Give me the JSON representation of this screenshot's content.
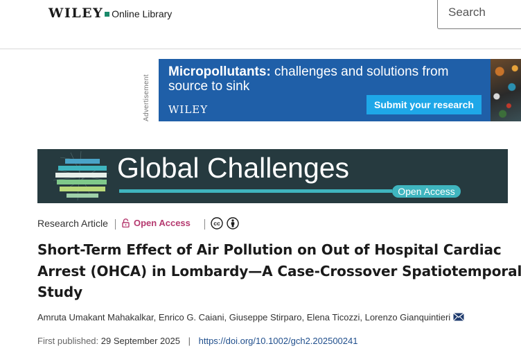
{
  "header": {
    "logo_brand": "WILEY",
    "logo_product": "Online Library",
    "search_placeholder": "Search"
  },
  "advertisement": {
    "label": "Advertisement",
    "headline_bold": "Micropollutants:",
    "headline_rest": " challenges and solutions from source to sink",
    "brand": "WILEY",
    "cta": "Submit your research",
    "colors": {
      "background": "#1f5fa8",
      "button": "#1ea7e8"
    }
  },
  "journal_banner": {
    "title": "Global Challenges",
    "badge": "Open Access",
    "colors": {
      "background": "#263a3f",
      "accent": "#3fb5bf"
    }
  },
  "article": {
    "type": "Research Article",
    "access": "Open Access",
    "license_icons": [
      "creative-commons-icon",
      "attribution-icon"
    ],
    "title": "Short-Term Effect of Air Pollution on Out of Hospital Cardiac Arrest (OHCA) in Lombardy—A Case-Crossover Spatiotemporal Study",
    "authors": [
      "Amruta Umakant Mahakalkar",
      "Enrico G. Caiani",
      "Giuseppe Stirparo",
      "Elena Ticozzi",
      "Lorenzo Gianquintieri"
    ],
    "corresponding_author_icon": "envelope-icon",
    "first_published_label": "First published:",
    "first_published_date": "29 September 2025",
    "separator": "|",
    "doi": "https://doi.org/10.1002/gch2.202500241",
    "colors": {
      "open_access": "#b5396f",
      "doi_link": "#1f4e8c"
    }
  }
}
